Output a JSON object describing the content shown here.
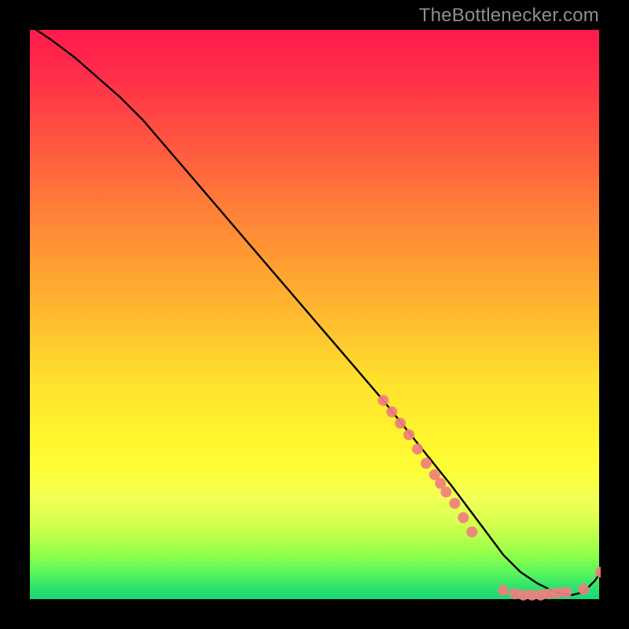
{
  "watermark": "TheBottlenecker.com",
  "chart_data": {
    "type": "line",
    "title": "",
    "xlabel": "",
    "ylabel": "",
    "xlim": [
      0,
      100
    ],
    "ylim": [
      0,
      100
    ],
    "series": [
      {
        "name": "bottleneck-curve",
        "x": [
          1,
          4,
          8,
          12,
          16,
          20,
          26,
          32,
          38,
          44,
          50,
          56,
          62,
          66,
          70,
          74,
          77,
          80,
          83,
          86,
          89,
          92,
          95,
          97,
          99,
          100
        ],
        "y": [
          100,
          98,
          95,
          91.5,
          88,
          84,
          77,
          70,
          63,
          56,
          49,
          42,
          35,
          30,
          25,
          20,
          16,
          12,
          8,
          5,
          3,
          1.5,
          1,
          1.5,
          3.5,
          5
        ]
      }
    ],
    "markers": [
      {
        "x": 62,
        "y": 35
      },
      {
        "x": 63.5,
        "y": 33
      },
      {
        "x": 65,
        "y": 31
      },
      {
        "x": 66.5,
        "y": 29
      },
      {
        "x": 68,
        "y": 26.5
      },
      {
        "x": 69.5,
        "y": 24
      },
      {
        "x": 71,
        "y": 22
      },
      {
        "x": 72,
        "y": 20.5
      },
      {
        "x": 73,
        "y": 19
      },
      {
        "x": 74.5,
        "y": 17
      },
      {
        "x": 76,
        "y": 14.5
      },
      {
        "x": 77.5,
        "y": 12
      },
      {
        "x": 83,
        "y": 1.8
      },
      {
        "x": 85,
        "y": 1.2
      },
      {
        "x": 86.5,
        "y": 1
      },
      {
        "x": 88,
        "y": 1
      },
      {
        "x": 89.5,
        "y": 1
      },
      {
        "x": 91,
        "y": 1.2
      },
      {
        "x": 92.5,
        "y": 1.4
      },
      {
        "x": 94,
        "y": 1.5
      },
      {
        "x": 97,
        "y": 2
      },
      {
        "x": 100,
        "y": 5
      }
    ],
    "colors": {
      "curve": "#000000",
      "marker": "#ef7f7f"
    }
  }
}
